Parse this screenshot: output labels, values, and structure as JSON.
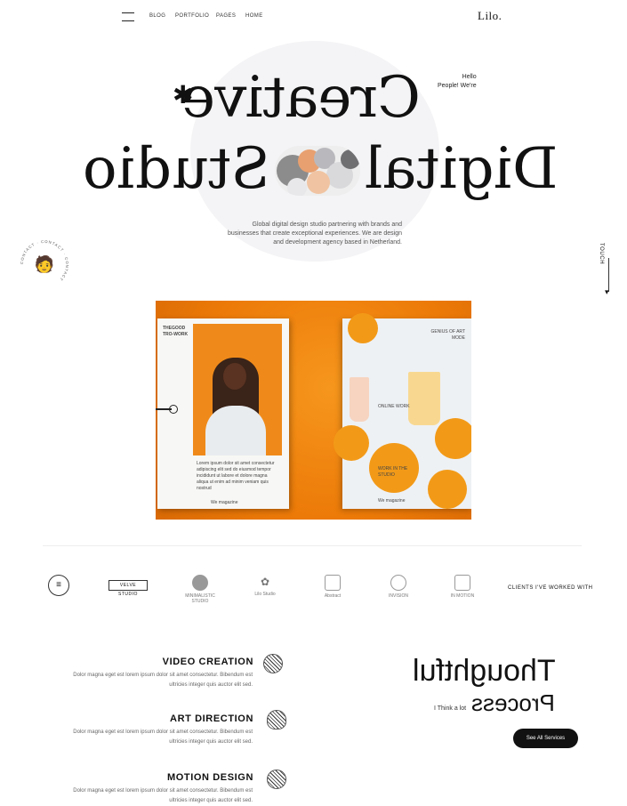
{
  "header": {
    "logo": "Lilo.",
    "nav": [
      "HOME",
      "PAGES",
      "PORTFOLIO",
      "BLOG"
    ]
  },
  "hero": {
    "greeting_line1": "Hello",
    "greeting_line2": "People! We're",
    "word1": "Creative",
    "word2_left": "Digital",
    "word2_right": "Studio",
    "description": "Global digital design studio partnering with brands and businesses that create exceptional experiences. We are design and development agency based in Netherland.",
    "avatar_ring": "CONTACT · CONTACT · CONTACT",
    "touch_label": "TOUCH"
  },
  "magazine": {
    "left_title": "THEGOOD TRO-WORK",
    "right_head": "GENIUS OF ART MODE",
    "right_sub": "ONLINE WORK",
    "right_caption": "WORK IN THE STUDIO",
    "footer_left": "We magazine",
    "footer_right": "We magazine",
    "body_text": "Lorem ipsum dolor sit amet consectetur adipiscing elit sed do eiusmod tempor incididunt ut labore et dolore magna aliqua ut enim ad minim veniam quis nostrud"
  },
  "clients": {
    "label": "CLIENTS I'VE WORKED WITH",
    "logos": [
      "IN MOTION",
      "INVISION",
      "Abstract",
      "Lilo Studio",
      "MINIMALISTIC STUDIO",
      "VELVE STUDIO"
    ]
  },
  "services": [
    {
      "title": "VIDEO CREATION",
      "text": "Dolor magna eget est lorem ipsum dolor sit amet consectetur. Bibendum est ultricies integer quis auctor elit sed."
    },
    {
      "title": "ART DIRECTION",
      "text": "Dolor magna eget est lorem ipsum dolor sit amet consectetur. Bibendum est ultricies integer quis auctor elit sed."
    },
    {
      "title": "MOTION DESIGN",
      "text": "Dolor magna eget est lorem ipsum dolor sit amet consectetur. Bibendum est ultricies integer quis auctor elit sed."
    }
  ],
  "process": {
    "heading1": "Thoughtful",
    "heading2": "Process",
    "tagline": "I Think a lot",
    "button": "See All Services"
  },
  "colors": {
    "accent": "#f08412",
    "dark": "#111111"
  }
}
